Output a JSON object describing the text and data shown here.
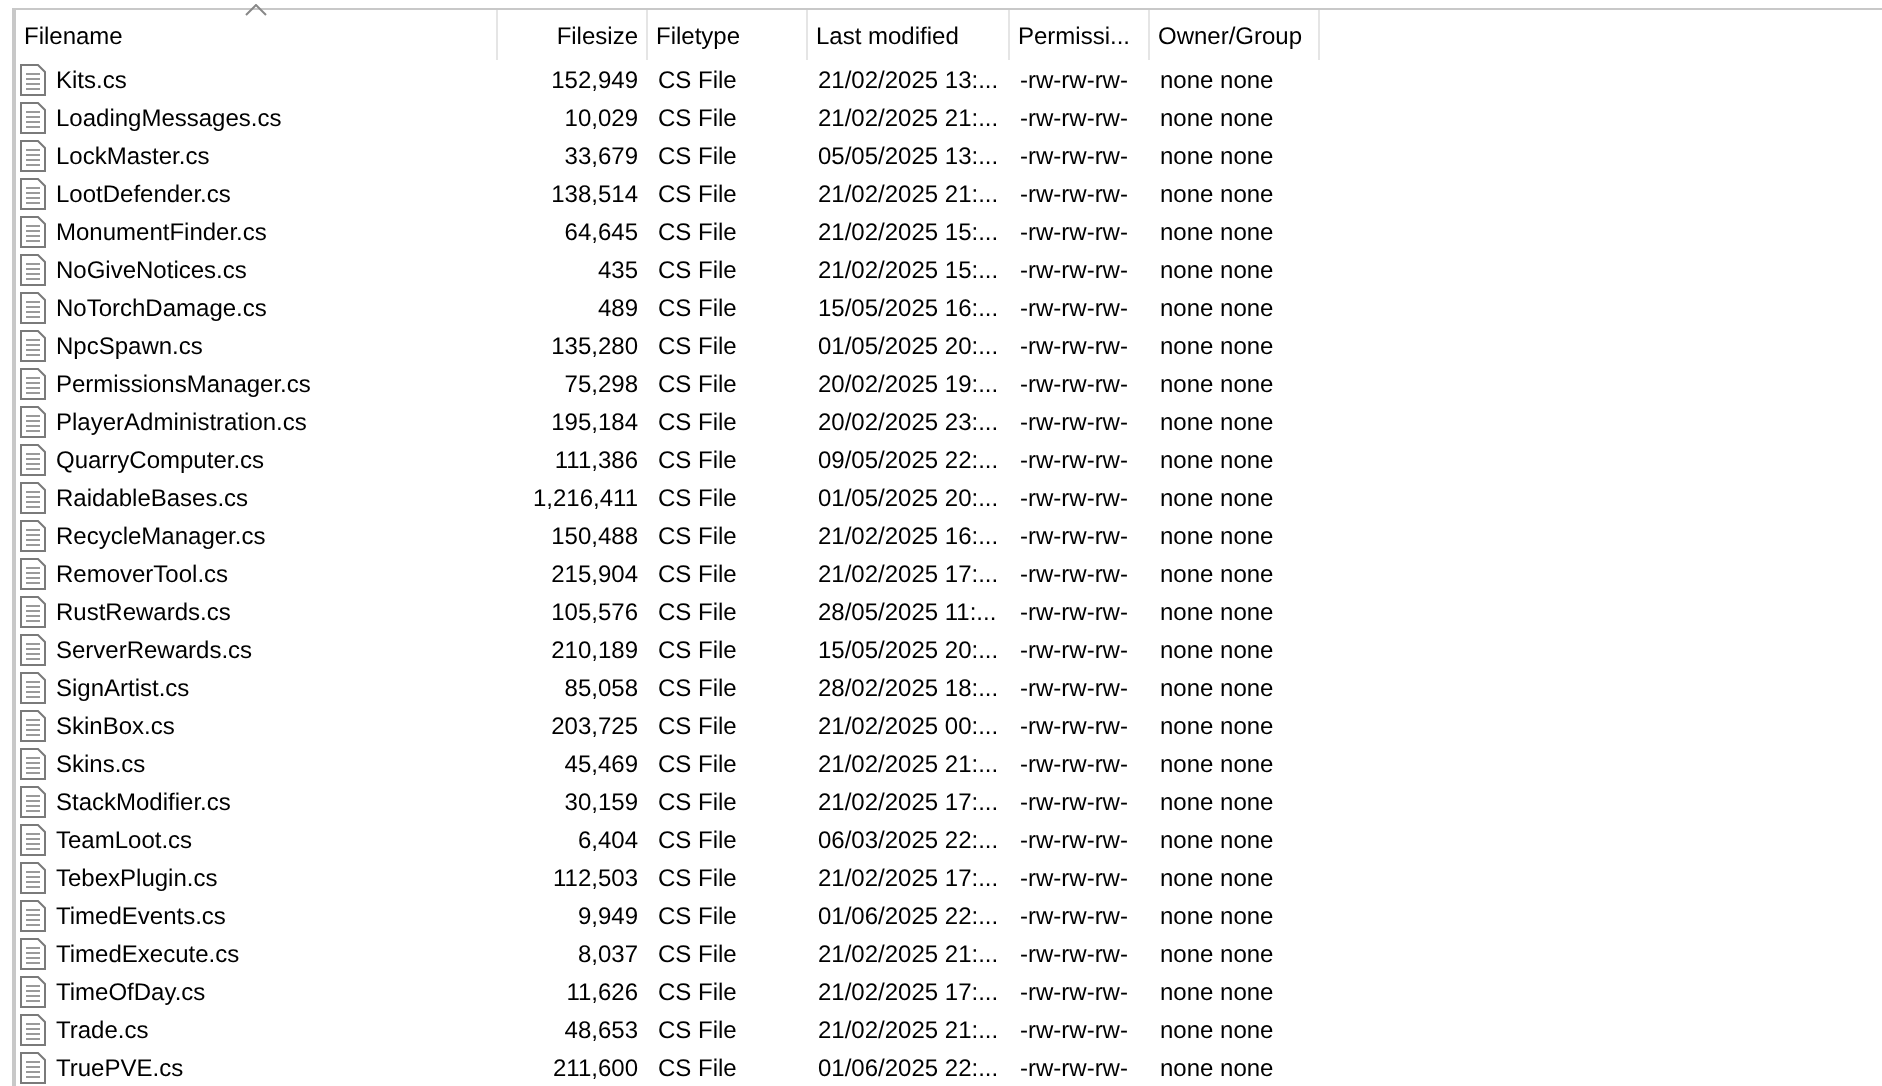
{
  "columns": [
    {
      "label": "Filename",
      "kind": "text",
      "sorted": true
    },
    {
      "label": "Filesize",
      "kind": "number",
      "sorted": false
    },
    {
      "label": "Filetype",
      "kind": "text",
      "sorted": false
    },
    {
      "label": "Last modified",
      "kind": "text",
      "sorted": false
    },
    {
      "label": "Permissi...",
      "kind": "text",
      "sorted": false
    },
    {
      "label": "Owner/Group",
      "kind": "text",
      "sorted": false
    }
  ],
  "rows": [
    [
      "Kits.cs",
      "152,949",
      "CS File",
      "21/02/2025 13:...",
      "-rw-rw-rw-",
      "none none"
    ],
    [
      "LoadingMessages.cs",
      "10,029",
      "CS File",
      "21/02/2025 21:...",
      "-rw-rw-rw-",
      "none none"
    ],
    [
      "LockMaster.cs",
      "33,679",
      "CS File",
      "05/05/2025 13:...",
      "-rw-rw-rw-",
      "none none"
    ],
    [
      "LootDefender.cs",
      "138,514",
      "CS File",
      "21/02/2025 21:...",
      "-rw-rw-rw-",
      "none none"
    ],
    [
      "MonumentFinder.cs",
      "64,645",
      "CS File",
      "21/02/2025 15:...",
      "-rw-rw-rw-",
      "none none"
    ],
    [
      "NoGiveNotices.cs",
      "435",
      "CS File",
      "21/02/2025 15:...",
      "-rw-rw-rw-",
      "none none"
    ],
    [
      "NoTorchDamage.cs",
      "489",
      "CS File",
      "15/05/2025 16:...",
      "-rw-rw-rw-",
      "none none"
    ],
    [
      "NpcSpawn.cs",
      "135,280",
      "CS File",
      "01/05/2025 20:...",
      "-rw-rw-rw-",
      "none none"
    ],
    [
      "PermissionsManager.cs",
      "75,298",
      "CS File",
      "20/02/2025 19:...",
      "-rw-rw-rw-",
      "none none"
    ],
    [
      "PlayerAdministration.cs",
      "195,184",
      "CS File",
      "20/02/2025 23:...",
      "-rw-rw-rw-",
      "none none"
    ],
    [
      "QuarryComputer.cs",
      "111,386",
      "CS File",
      "09/05/2025 22:...",
      "-rw-rw-rw-",
      "none none"
    ],
    [
      "RaidableBases.cs",
      "1,216,411",
      "CS File",
      "01/05/2025 20:...",
      "-rw-rw-rw-",
      "none none"
    ],
    [
      "RecycleManager.cs",
      "150,488",
      "CS File",
      "21/02/2025 16:...",
      "-rw-rw-rw-",
      "none none"
    ],
    [
      "RemoverTool.cs",
      "215,904",
      "CS File",
      "21/02/2025 17:...",
      "-rw-rw-rw-",
      "none none"
    ],
    [
      "RustRewards.cs",
      "105,576",
      "CS File",
      "28/05/2025 11:...",
      "-rw-rw-rw-",
      "none none"
    ],
    [
      "ServerRewards.cs",
      "210,189",
      "CS File",
      "15/05/2025 20:...",
      "-rw-rw-rw-",
      "none none"
    ],
    [
      "SignArtist.cs",
      "85,058",
      "CS File",
      "28/02/2025 18:...",
      "-rw-rw-rw-",
      "none none"
    ],
    [
      "SkinBox.cs",
      "203,725",
      "CS File",
      "21/02/2025 00:...",
      "-rw-rw-rw-",
      "none none"
    ],
    [
      "Skins.cs",
      "45,469",
      "CS File",
      "21/02/2025 21:...",
      "-rw-rw-rw-",
      "none none"
    ],
    [
      "StackModifier.cs",
      "30,159",
      "CS File",
      "21/02/2025 17:...",
      "-rw-rw-rw-",
      "none none"
    ],
    [
      "TeamLoot.cs",
      "6,404",
      "CS File",
      "06/03/2025 22:...",
      "-rw-rw-rw-",
      "none none"
    ],
    [
      "TebexPlugin.cs",
      "112,503",
      "CS File",
      "21/02/2025 17:...",
      "-rw-rw-rw-",
      "none none"
    ],
    [
      "TimedEvents.cs",
      "9,949",
      "CS File",
      "01/06/2025 22:...",
      "-rw-rw-rw-",
      "none none"
    ],
    [
      "TimedExecute.cs",
      "8,037",
      "CS File",
      "21/02/2025 21:...",
      "-rw-rw-rw-",
      "none none"
    ],
    [
      "TimeOfDay.cs",
      "11,626",
      "CS File",
      "21/02/2025 17:...",
      "-rw-rw-rw-",
      "none none"
    ],
    [
      "Trade.cs",
      "48,653",
      "CS File",
      "21/02/2025 21:...",
      "-rw-rw-rw-",
      "none none"
    ],
    [
      "TruePVE.cs",
      "211,600",
      "CS File",
      "01/06/2025 22:...",
      "-rw-rw-rw-",
      "none none"
    ]
  ]
}
